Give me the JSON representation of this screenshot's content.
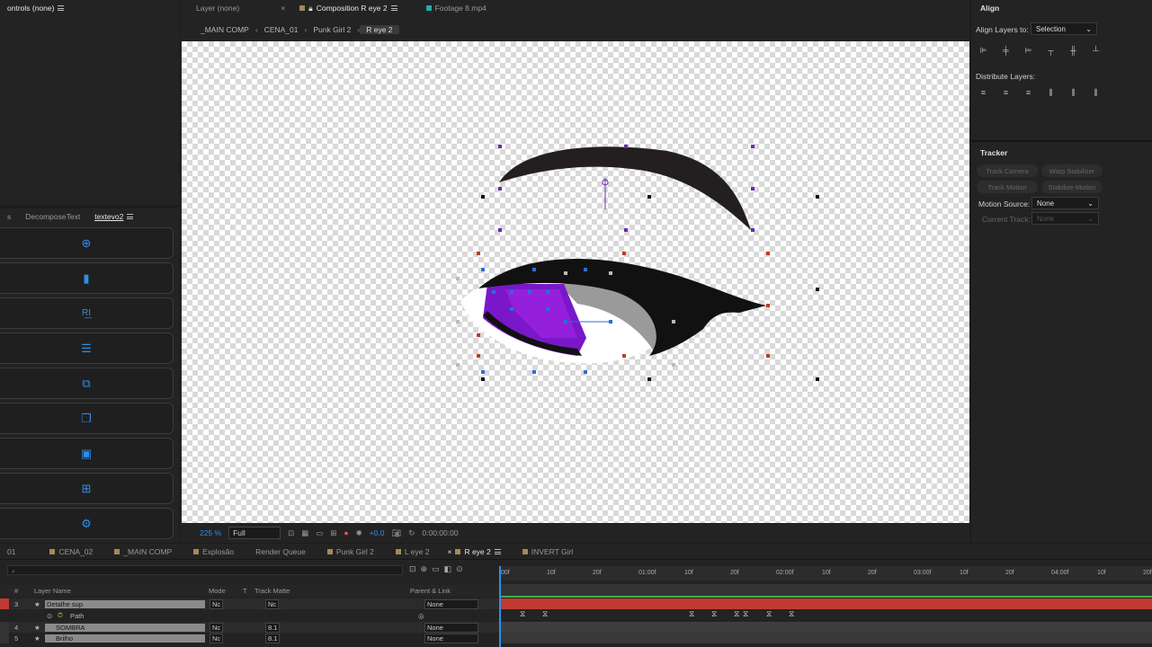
{
  "effect_controls": {
    "title": "ontrols (none)"
  },
  "script_panel": {
    "tabs": [
      "s",
      "DecomposeText",
      "textevo2"
    ]
  },
  "comp_tabs": {
    "layer": "Layer (none)",
    "composition": "Composition R eye 2",
    "footage": "Footage 8.mp4"
  },
  "breadcrumbs": [
    "_MAIN COMP",
    "CENA_01",
    "Punk Girl 2",
    "R eye 2"
  ],
  "comp_footer": {
    "zoom": "225 %",
    "resolution": "Full",
    "exposure": "+0,0",
    "timecode": "0:00:00:00"
  },
  "align_panel": {
    "title": "Align",
    "align_to_label": "Align Layers to:",
    "align_to_value": "Selection",
    "distribute_label": "Distribute Layers:"
  },
  "tracker_panel": {
    "title": "Tracker",
    "buttons": [
      "Track Camera",
      "Warp Stabilizer",
      "Track Motion",
      "Stabilize Motion"
    ],
    "motion_source_label": "Motion Source:",
    "motion_source_value": "None",
    "current_track_label": "Current Track:",
    "current_track_value": "None"
  },
  "timeline_tabs": [
    "01",
    "CENA_02",
    "_MAIN COMP",
    "Explosão",
    "Render Queue",
    "Punk Girl 2",
    "L eye 2",
    "R eye 2",
    "INVERT Girl"
  ],
  "timeline": {
    "columns": [
      "#",
      "Layer Name",
      "Mode",
      "T",
      "Track Matte",
      "Parent & Link"
    ],
    "layers": [
      {
        "num": "3",
        "name": "Detalhe sup",
        "mode": "Nc",
        "matte": "Nc",
        "parent": "None"
      },
      {
        "num": "",
        "name": "Path",
        "mode": "",
        "matte": "",
        "parent": ""
      },
      {
        "num": "4",
        "name": "SOMBRA",
        "mode": "Nc",
        "matte": "8.1",
        "parent": "None"
      },
      {
        "num": "5",
        "name": "Brilho",
        "mode": "Nc",
        "matte": "8.1",
        "parent": "None"
      }
    ],
    "ruler": [
      "00f",
      "10f",
      "20f",
      "01:00f",
      "10f",
      "20f",
      "02:00f",
      "10f",
      "20f",
      "03:00f",
      "10f",
      "20f",
      "04:00f",
      "10f",
      "20f"
    ]
  },
  "colors": {
    "accent": "#2f8df0",
    "layer_red": "#c03a32",
    "panel": "#232323"
  }
}
